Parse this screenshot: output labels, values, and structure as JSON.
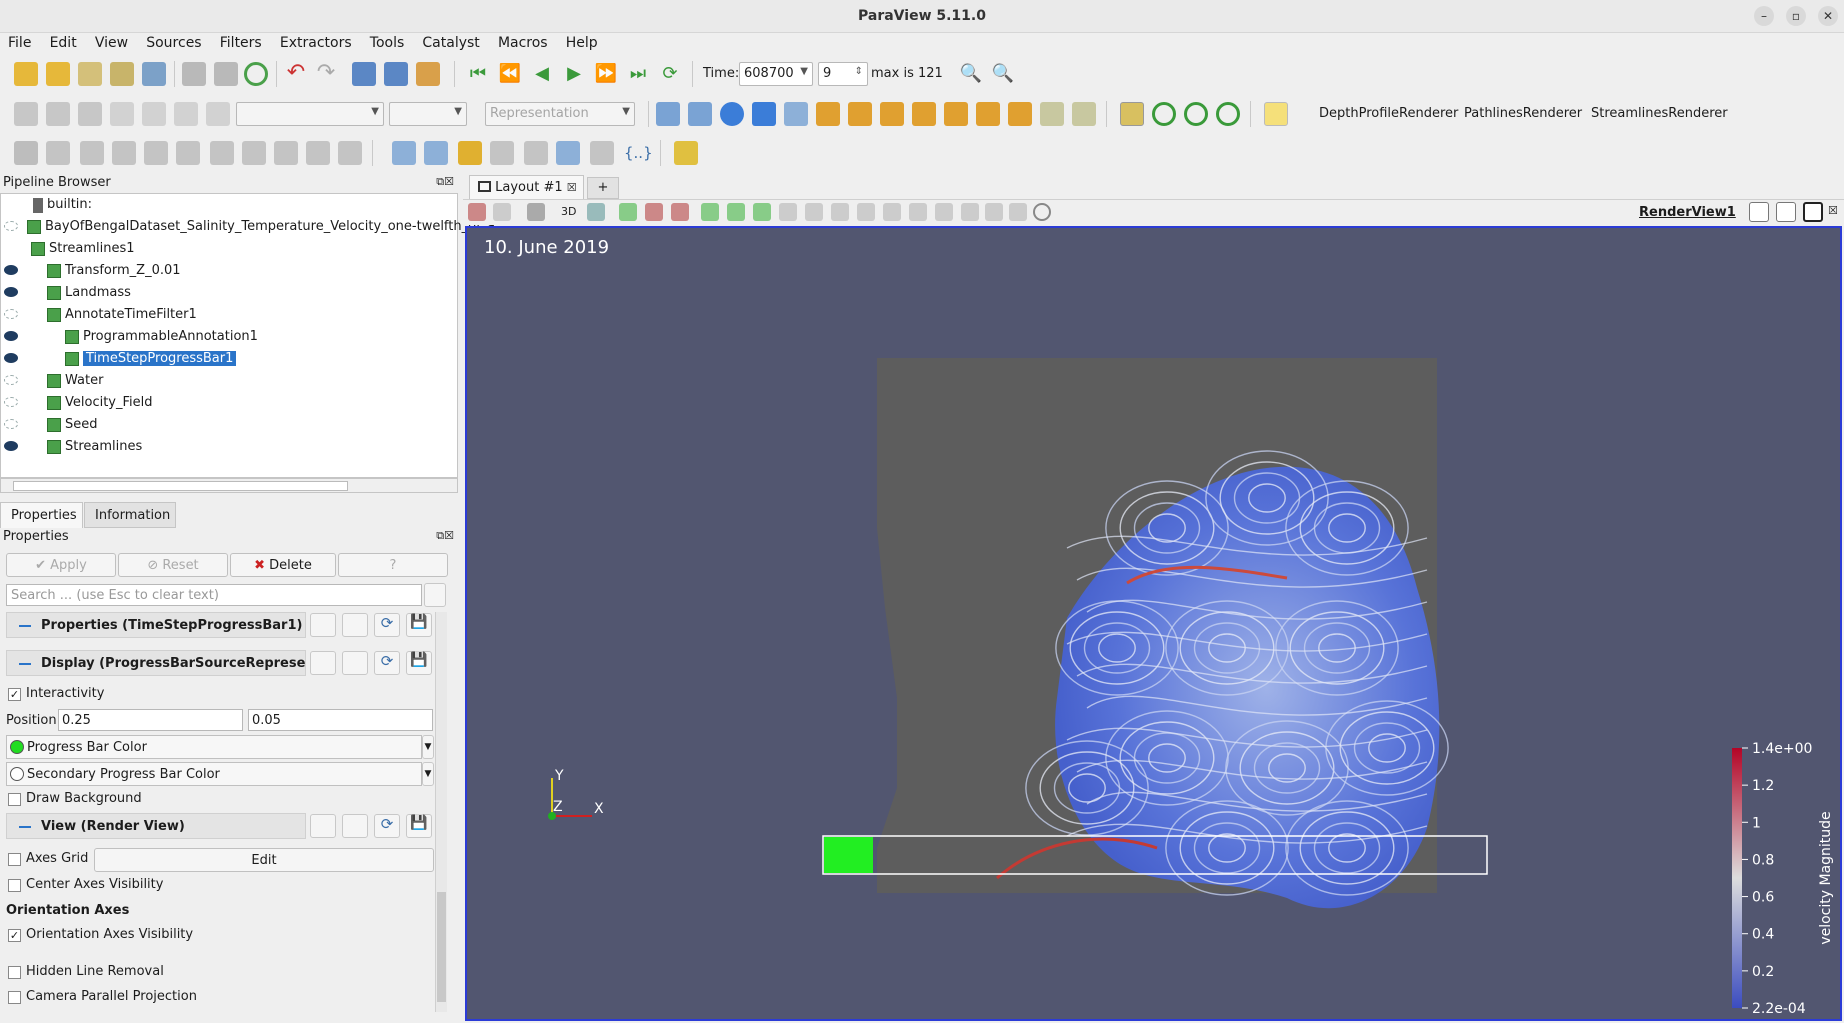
{
  "window": {
    "title": "ParaView 5.11.0"
  },
  "menu": [
    "File",
    "Edit",
    "View",
    "Sources",
    "Filters",
    "Extractors",
    "Tools",
    "Catalyst",
    "Macros",
    "Help"
  ],
  "time_toolbar": {
    "time_label": "Time:",
    "time_value": "608700",
    "step_value": "9",
    "max_label": "max is 121"
  },
  "toolbar2": {
    "representation_placeholder": "Representation",
    "plugins": [
      "DepthProfileRenderer",
      "PathlinesRenderer",
      "StreamlinesRenderer"
    ]
  },
  "pipeline": {
    "title": "Pipeline Browser",
    "items": [
      {
        "label": "builtin:",
        "visible": null,
        "indent": 0
      },
      {
        "label": "BayOfBengalDataset_Salinity_Temperature_Velocity_one-twelfth_of_a",
        "visible": false,
        "indent": 0
      },
      {
        "label": "Streamlines1",
        "visible": null,
        "indent": 1
      },
      {
        "label": "Transform_Z_0.01",
        "visible": true,
        "indent": 2
      },
      {
        "label": "Landmass",
        "visible": true,
        "indent": 2
      },
      {
        "label": "AnnotateTimeFilter1",
        "visible": false,
        "indent": 3
      },
      {
        "label": "ProgrammableAnnotation1",
        "visible": true,
        "indent": 4
      },
      {
        "label": "TimeStepProgressBar1",
        "visible": true,
        "indent": 4,
        "selected": true
      },
      {
        "label": "Water",
        "visible": false,
        "indent": 2
      },
      {
        "label": "Velocity_Field",
        "visible": false,
        "indent": 2
      },
      {
        "label": "Seed",
        "visible": false,
        "indent": 2
      },
      {
        "label": "Streamlines",
        "visible": true,
        "indent": 2
      }
    ]
  },
  "tabs": {
    "properties": "Properties",
    "information": "Information"
  },
  "properties": {
    "title": "Properties",
    "apply": "Apply",
    "reset": "Reset",
    "delete": "Delete",
    "help": "?",
    "search_placeholder": "Search ... (use Esc to clear text)",
    "section_properties": "Properties (TimeStepProgressBar1)",
    "section_display": "Display (ProgressBarSourceRepresent",
    "interactivity": "Interactivity",
    "position_label": "Position",
    "position_x": "0.25",
    "position_y": "0.05",
    "progress_bar_color": "Progress Bar Color",
    "progress_bar_color_value": "#22dd22",
    "secondary_color": "Secondary Progress Bar Color",
    "draw_background": "Draw Background",
    "section_view": "View (Render View)",
    "axes_grid": "Axes Grid",
    "edit": "Edit",
    "center_axes": "Center Axes Visibility",
    "orientation_axes_heading": "Orientation Axes",
    "orientation_axes_visibility": "Orientation Axes Visibility",
    "hidden_line_removal": "Hidden Line Removal",
    "camera_parallel": "Camera Parallel Projection"
  },
  "layout": {
    "tab": "Layout #1",
    "add": "+",
    "view_name": "RenderView1",
    "view_3d": "3D"
  },
  "render": {
    "date_text": "10. June 2019",
    "progress": 0.074,
    "axes": {
      "y": "Y",
      "z": "Z",
      "x": "X"
    },
    "colorbar": {
      "title": "velocity Magnitude",
      "ticks": [
        "1.4e+00",
        "1.2",
        "1",
        "0.8",
        "0.6",
        "0.4",
        "0.2",
        "2.2e-04"
      ]
    }
  }
}
